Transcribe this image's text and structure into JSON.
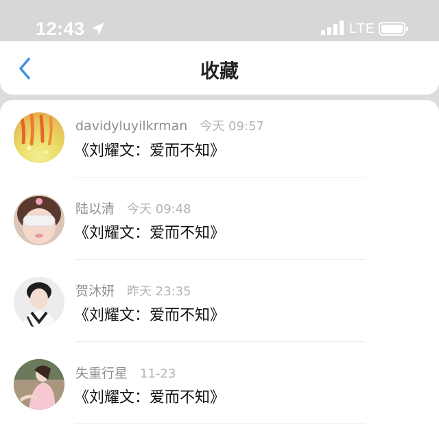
{
  "status_bar": {
    "time": "12:43",
    "network": "LTE",
    "location_icon": "location-arrow-icon",
    "signal_icon": "cellular-signal-icon",
    "battery_icon": "battery-icon"
  },
  "nav": {
    "title": "收藏",
    "back_icon": "chevron-left-icon",
    "accent_color": "#3a8ee6"
  },
  "favorites": [
    {
      "name": "davidyluyilkrman",
      "time": "今天 09:57",
      "content": "《刘耀文：爱而不知》"
    },
    {
      "name": "陆以清",
      "time": "今天 09:48",
      "content": "《刘耀文：爱而不知》"
    },
    {
      "name": "贺沐妍",
      "time": "昨天 23:35",
      "content": "《刘耀文：爱而不知》"
    },
    {
      "name": "失重行星",
      "time": "11-23",
      "content": "《刘耀文：爱而不知》"
    }
  ]
}
